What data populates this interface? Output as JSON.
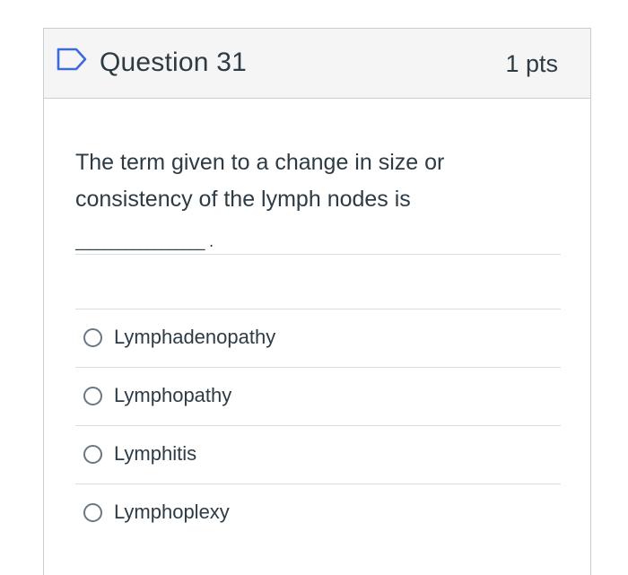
{
  "question": {
    "title": "Question 31",
    "points": "1 pts",
    "prompt": "The term given to a change in size or consistency of the lymph nodes is",
    "blank": "__________________ ."
  },
  "answers": [
    {
      "label": "Lymphadenopathy",
      "selected": false
    },
    {
      "label": "Lymphopathy",
      "selected": false
    },
    {
      "label": "Lymphitis",
      "selected": false
    },
    {
      "label": "Lymphoplexy",
      "selected": false
    }
  ],
  "icons": {
    "flag": "flag-icon",
    "radio": "radio-button-icon"
  },
  "colors": {
    "text": "#2d3b45",
    "header_bg": "#f5f5f5",
    "border": "#c7cdd1",
    "flag_accent": "#3d6bd9"
  }
}
